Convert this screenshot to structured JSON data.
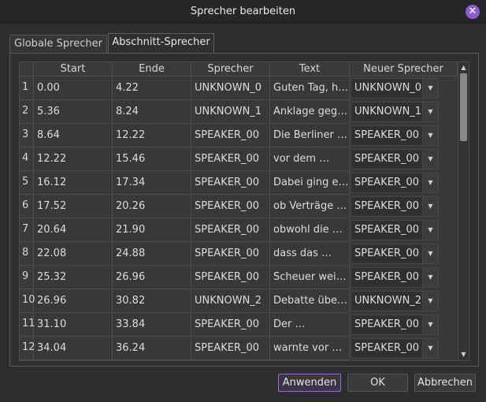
{
  "window": {
    "title": "Sprecher bearbeiten",
    "close_icon": "close-icon"
  },
  "tabs": [
    {
      "label": "Globale Sprecher"
    },
    {
      "label": "Abschnitt-Sprecher"
    }
  ],
  "table": {
    "headers": {
      "start": "Start",
      "end": "Ende",
      "speaker": "Sprecher",
      "text": "Text",
      "new_speaker": "Neuer Sprecher"
    },
    "rows": [
      {
        "num": "1",
        "start": "0.00",
        "end": "4.22",
        "speaker": "UNKNOWN_0",
        "text": "Guten Tag, hi…",
        "new_speaker": "UNKNOWN_0"
      },
      {
        "num": "2",
        "start": "5.36",
        "end": "8.24",
        "speaker": "UNKNOWN_1",
        "text": "Anklage gege…",
        "new_speaker": "UNKNOWN_1"
      },
      {
        "num": "3",
        "start": "8.64",
        "end": "12.22",
        "speaker": "SPEAKER_00",
        "text": "Die Berliner …",
        "new_speaker": "SPEAKER_00"
      },
      {
        "num": "4",
        "start": "12.22",
        "end": "15.46",
        "speaker": "SPEAKER_00",
        "text": "vor dem …",
        "new_speaker": "SPEAKER_00"
      },
      {
        "num": "5",
        "start": "16.12",
        "end": "17.34",
        "speaker": "SPEAKER_00",
        "text": "Dabei ging es…",
        "new_speaker": "SPEAKER_00"
      },
      {
        "num": "6",
        "start": "17.52",
        "end": "20.26",
        "speaker": "SPEAKER_00",
        "text": "ob Verträge …",
        "new_speaker": "SPEAKER_00"
      },
      {
        "num": "7",
        "start": "20.64",
        "end": "21.90",
        "speaker": "SPEAKER_00",
        "text": "obwohl die …",
        "new_speaker": "SPEAKER_00"
      },
      {
        "num": "8",
        "start": "22.08",
        "end": "24.88",
        "speaker": "SPEAKER_00",
        "text": "dass das …",
        "new_speaker": "SPEAKER_00"
      },
      {
        "num": "9",
        "start": "25.32",
        "end": "26.96",
        "speaker": "SPEAKER_00",
        "text": "Scheuer weis…",
        "new_speaker": "SPEAKER_00"
      },
      {
        "num": "10",
        "start": "26.96",
        "end": "30.82",
        "speaker": "UNKNOWN_2",
        "text": "Debatte über…",
        "new_speaker": "UNKNOWN_2"
      },
      {
        "num": "11",
        "start": "31.10",
        "end": "33.84",
        "speaker": "SPEAKER_00",
        "text": "Der …",
        "new_speaker": "SPEAKER_00"
      },
      {
        "num": "12",
        "start": "34.04",
        "end": "36.24",
        "speaker": "SPEAKER_00",
        "text": "warnte vor …",
        "new_speaker": "SPEAKER_00"
      }
    ]
  },
  "buttons": {
    "apply": "Anwenden",
    "ok": "OK",
    "cancel": "Abbrechen"
  },
  "colors": {
    "accent": "#9a68d8",
    "close": "#8e5bd0",
    "background": "#2d2d2d"
  }
}
